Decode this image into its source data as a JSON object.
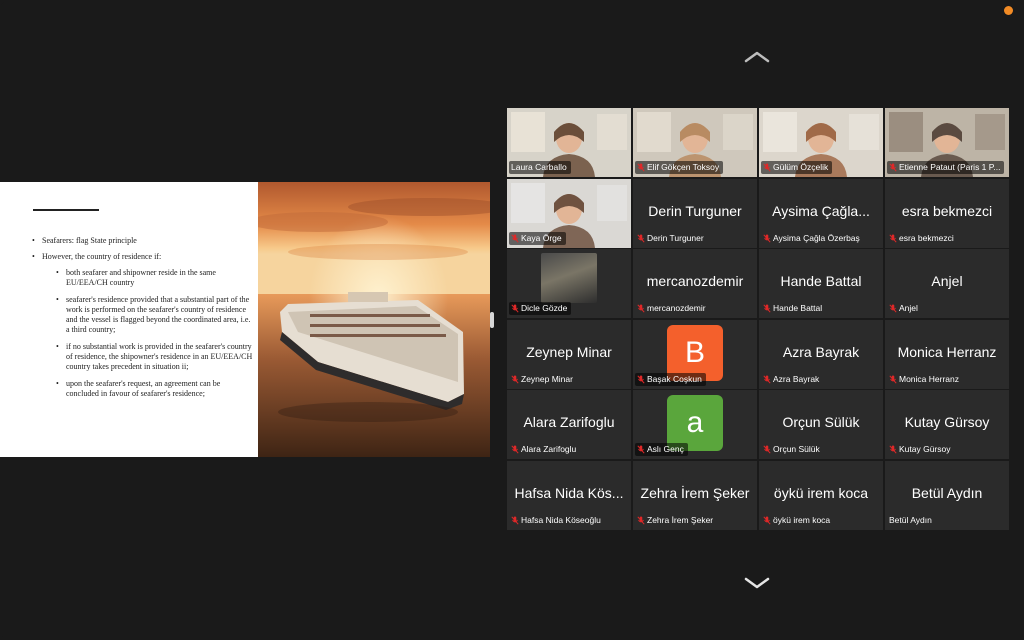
{
  "window": {
    "recording_dot_color": "#f28b25"
  },
  "slide": {
    "bullets": [
      {
        "text": "Seafarers: flag State principle"
      },
      {
        "text": "However, the country of residence if:",
        "sub": [
          "both seafarer and shipowner reside in the same EU/EEA/CH country",
          "seafarer's residence provided that a substantial part of the work is performed on the seafarer's country of residence and the vessel is flagged beyond the coordinated area, i.e. a third country;",
          "if no substantial work is provided in the seafarer's country of residence, the shipowner's residence in an EU/EEA/CH country takes precedent in situation ii;",
          "upon the seafarer's request, an agreement can be concluded in favour of seafarer's residence;"
        ]
      }
    ],
    "image_icon": "cruise-ship-at-sunset"
  },
  "navigation": {
    "up_icon": "chevron-up-icon",
    "down_icon": "chevron-down-icon"
  },
  "gallery": {
    "active_speaker_color": "#2dbf4e",
    "muted_icon_color": "#e02828",
    "participants": [
      {
        "name": "Laura Carballo",
        "display": "",
        "video": true,
        "muted": false,
        "active": true
      },
      {
        "name": "Elif Gökçen Toksoy",
        "display": "",
        "video": true,
        "muted": true
      },
      {
        "name": "Gülüm Özçelik",
        "display": "",
        "video": true,
        "muted": true
      },
      {
        "name": "Etienne Pataut (Paris 1 P...",
        "display": "",
        "video": true,
        "muted": true
      },
      {
        "name": "Kaya Örge",
        "display": "",
        "video": true,
        "muted": true
      },
      {
        "name": "Derin Turguner",
        "display": "Derin Turguner",
        "muted": true
      },
      {
        "name": "Aysima Çağla Özerbaş",
        "display": "Aysima Çağla...",
        "muted": true
      },
      {
        "name": "esra bekmezci",
        "display": "esra bekmezci",
        "muted": true
      },
      {
        "name": "Dicle Gözde",
        "display": "",
        "photo": true,
        "muted": true
      },
      {
        "name": "mercanozdemir",
        "display": "mercanozdemir",
        "muted": true
      },
      {
        "name": "Hande Battal",
        "display": "Hande Battal",
        "muted": true
      },
      {
        "name": "Anjel",
        "display": "Anjel",
        "muted": true
      },
      {
        "name": "Zeynep Minar",
        "display": "Zeynep Minar",
        "muted": true
      },
      {
        "name": "Başak Coşkun",
        "display": "",
        "avatar_letter": "B",
        "avatar_color": "#f4602c",
        "muted": true
      },
      {
        "name": "Azra Bayrak",
        "display": "Azra Bayrak",
        "muted": true
      },
      {
        "name": "Monica Herranz",
        "display": "Monica Herranz",
        "muted": true
      },
      {
        "name": "Alara Zarifoglu",
        "display": "Alara Zarifoglu",
        "muted": true
      },
      {
        "name": "Aslı Genç",
        "display": "",
        "avatar_letter": "a",
        "avatar_color": "#5aa63c",
        "muted": true
      },
      {
        "name": "Orçun Sülük",
        "display": "Orçun Sülük",
        "muted": true
      },
      {
        "name": "Kutay Gürsoy",
        "display": "Kutay Gürsoy",
        "muted": true
      },
      {
        "name": "Hafsa Nida Köseoğlu",
        "display": "Hafsa Nida Kös...",
        "muted": true
      },
      {
        "name": "Zehra İrem Şeker",
        "display": "Zehra İrem Şeker",
        "muted": true
      },
      {
        "name": "öykü irem koca",
        "display": "öykü irem koca",
        "muted": true
      },
      {
        "name": "Betül Aydın",
        "display": "Betül Aydın",
        "muted": false
      }
    ]
  }
}
